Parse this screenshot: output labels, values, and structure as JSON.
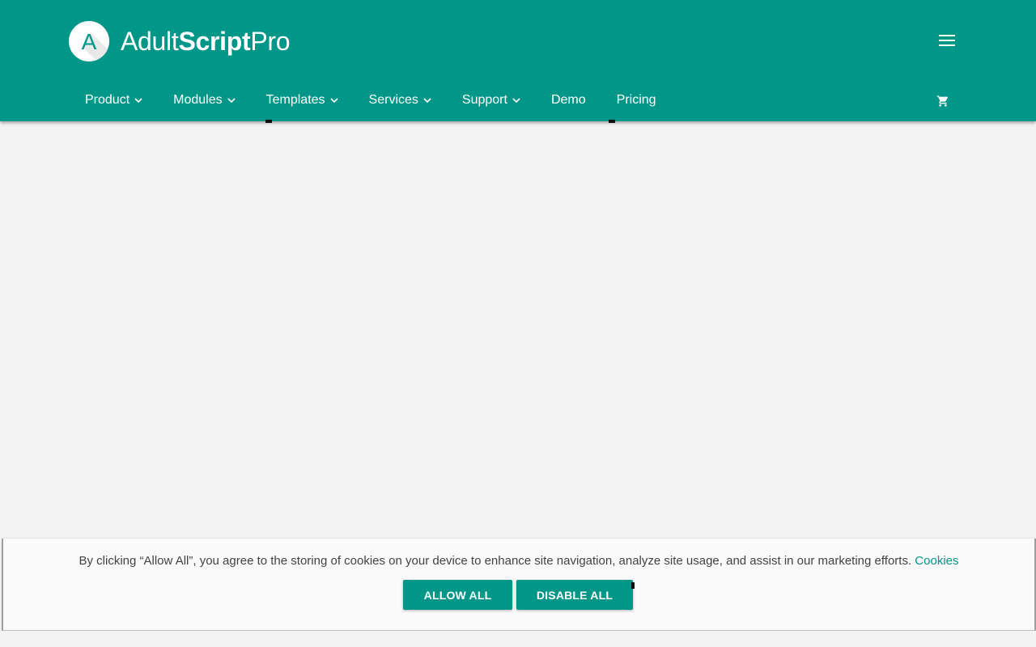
{
  "header": {
    "logo_letter": "A",
    "brand_light_1": "Adult",
    "brand_bold": "Script",
    "brand_light_2": "Pro",
    "menu_icon": "hamburger-menu-icon",
    "cart_icon": "shopping-cart-icon",
    "color": "#009688"
  },
  "nav": {
    "items": [
      {
        "label": "Product",
        "has_dropdown": true
      },
      {
        "label": "Modules",
        "has_dropdown": true
      },
      {
        "label": "Templates",
        "has_dropdown": true
      },
      {
        "label": "Services",
        "has_dropdown": true
      },
      {
        "label": "Support",
        "has_dropdown": true
      },
      {
        "label": "Demo",
        "has_dropdown": false
      },
      {
        "label": "Pricing",
        "has_dropdown": false
      }
    ]
  },
  "cookie_banner": {
    "message": "By clicking “Allow All”, you agree to the storing of cookies on your device to enhance site navigation, analyze site usage, and assist in our marketing efforts.",
    "link_label": "Cookies",
    "allow_label": "ALLOW ALL",
    "disable_label": "DISABLE ALL"
  }
}
